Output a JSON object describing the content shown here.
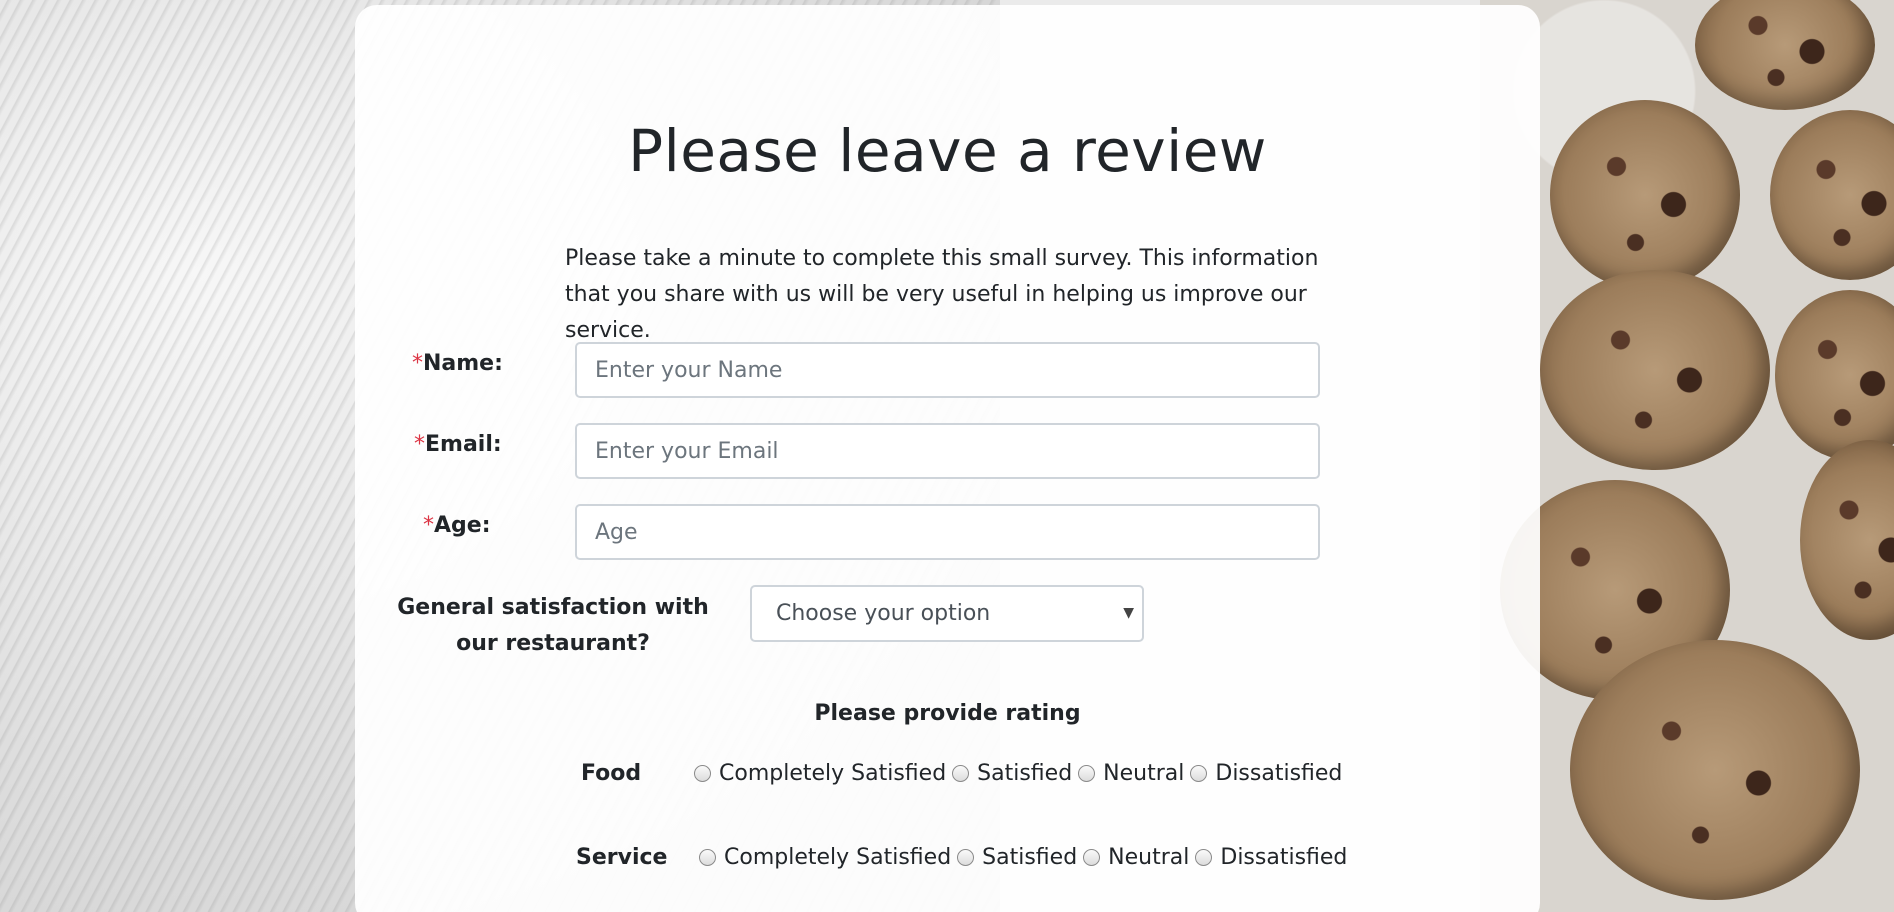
{
  "page": {
    "title": "Please leave a review",
    "description": "Please take a minute to complete this small survey. This information that you share with us will be very useful in helping us improve our service."
  },
  "form": {
    "required_mark": "*",
    "name": {
      "label": "Name:",
      "placeholder": "Enter your Name"
    },
    "email": {
      "label": "Email:",
      "placeholder": "Enter your Email"
    },
    "age": {
      "label": "Age:",
      "placeholder": "Age"
    },
    "satisfaction": {
      "label": "General satisfaction with our restaurant?",
      "selected": "Choose your option"
    }
  },
  "rating": {
    "heading": "Please provide rating",
    "options": [
      "Completely Satisfied",
      "Satisfied",
      "Neutral",
      "Dissatisfied"
    ],
    "rows": [
      {
        "category": "Food"
      },
      {
        "category": "Service"
      }
    ]
  },
  "colors": {
    "required": "#dc3545",
    "text": "#212529",
    "border": "#ced4da"
  }
}
